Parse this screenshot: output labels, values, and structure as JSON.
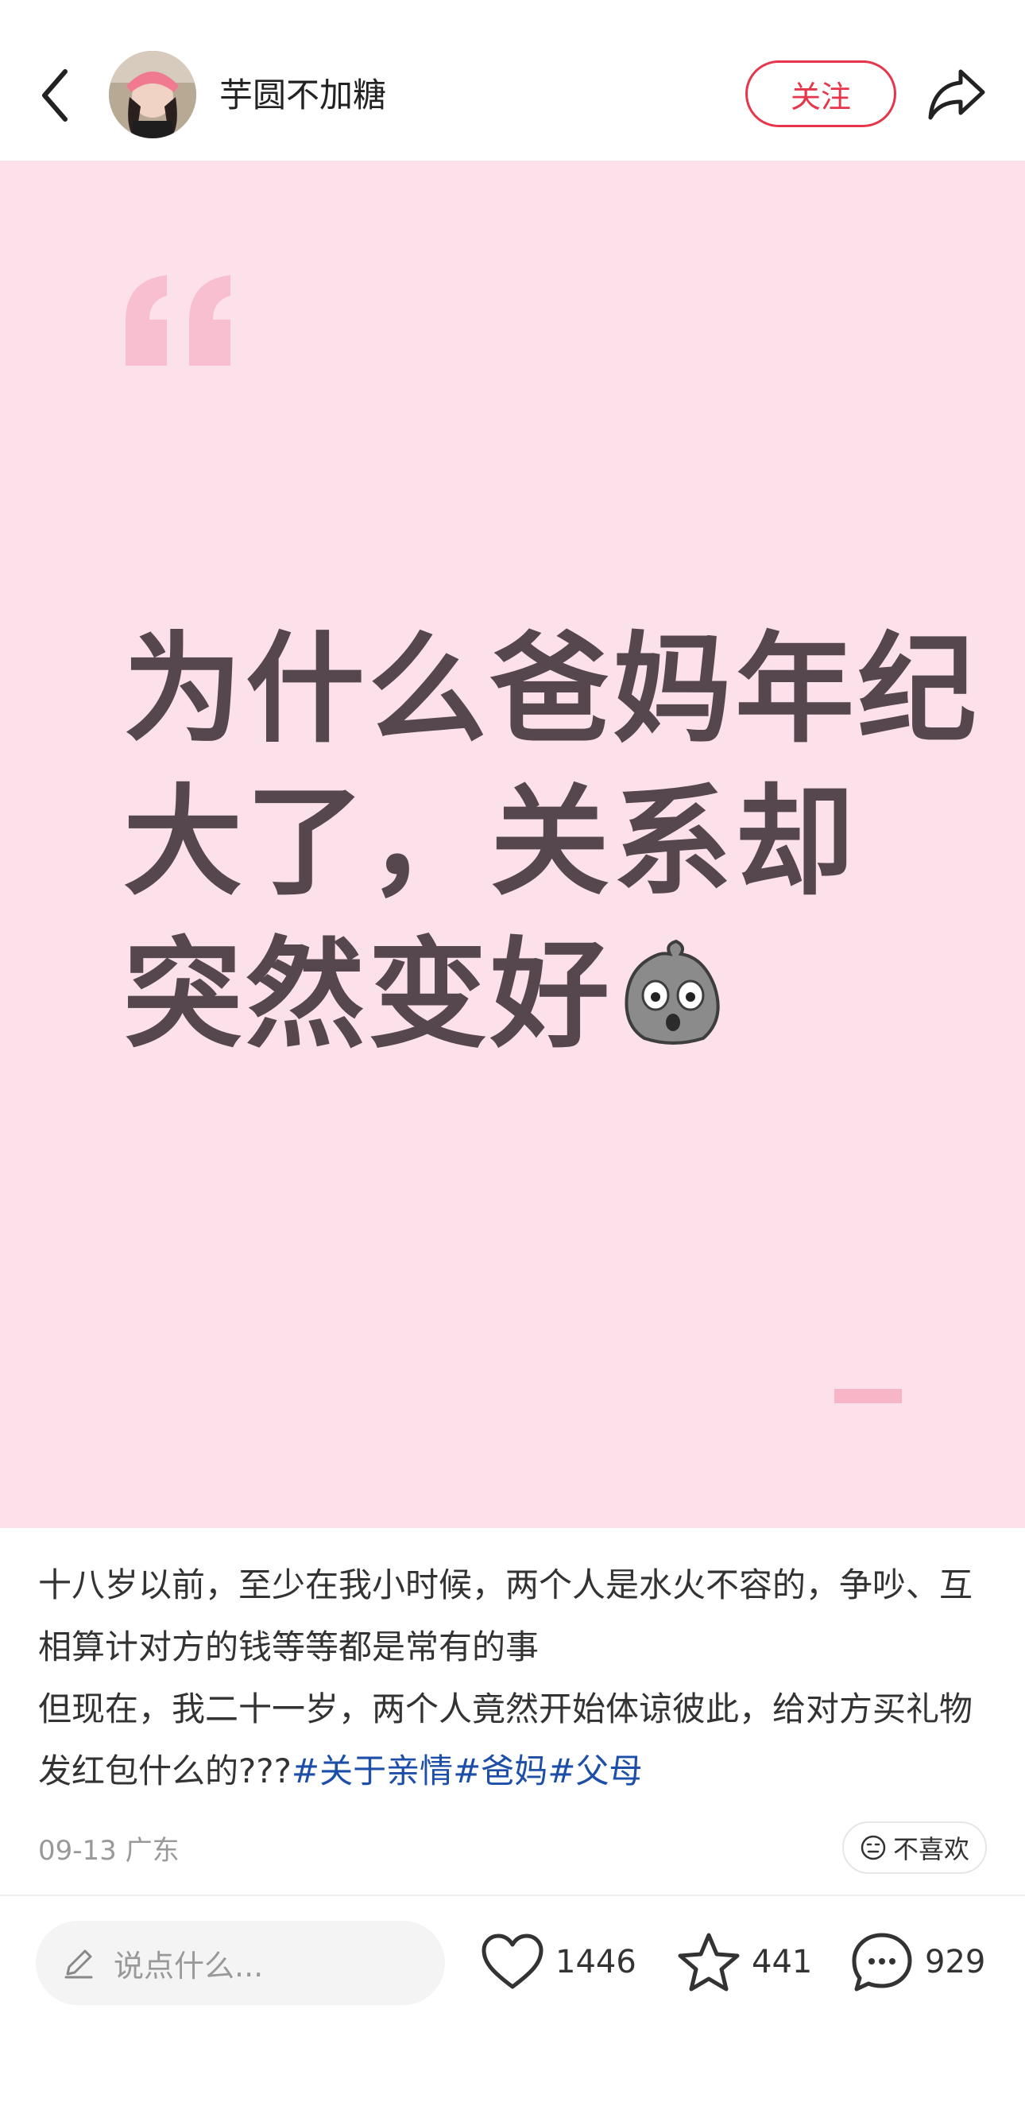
{
  "header": {
    "back_icon": "chevron-left-icon",
    "author_name": "芋圆不加糖",
    "follow_label": "关注",
    "share_icon": "share-icon"
  },
  "cover": {
    "background": "#fde1ea",
    "title_lines": [
      "为什么爸妈年纪",
      "大了，关系却",
      "突然变好"
    ],
    "emoji": "shocked-rock-emoji"
  },
  "post": {
    "paragraph_1": "十八岁以前，至少在我小时候，两个人是水火不容的，争吵、互相算计对方的钱等等都是常有的事",
    "paragraph_2": "但现在，我二十一岁，两个人竟然开始体谅彼此，给对方买礼物发红包什么的???",
    "hashtags": [
      "#关于亲情",
      "#爸妈",
      "#父母"
    ],
    "date": "09-13",
    "location": "广东",
    "dislike_label": "不喜欢"
  },
  "bottom_bar": {
    "comment_placeholder": "说点什么...",
    "likes": "1446",
    "collects": "441",
    "comments": "929"
  },
  "colors": {
    "accent": "#e5364b",
    "hashtag": "#1e4fa8"
  }
}
